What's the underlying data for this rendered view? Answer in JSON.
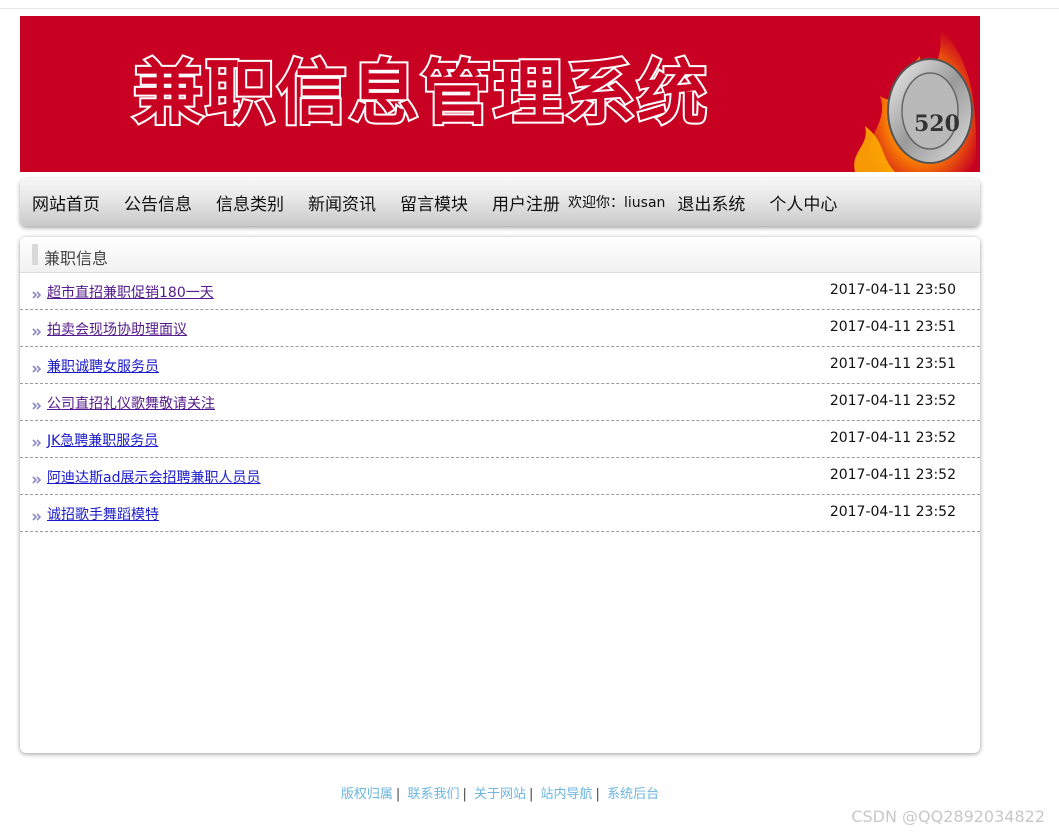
{
  "banner": {
    "title": "兼职信息管理系统",
    "emblem_text": "520",
    "background_color": "#c80021"
  },
  "nav": {
    "items": [
      {
        "label": "网站首页"
      },
      {
        "label": "公告信息"
      },
      {
        "label": "信息类别"
      },
      {
        "label": "新闻资讯"
      },
      {
        "label": "留言模块"
      },
      {
        "label": "用户注册"
      }
    ],
    "welcome": "欢迎你：liusan",
    "logout": "退出系统",
    "profile": "个人中心"
  },
  "panel": {
    "title": "兼职信息",
    "rows": [
      {
        "title": "超市直招兼职促销180一天",
        "date": "2017-04-11 23:50",
        "visited": true
      },
      {
        "title": "拍卖会现场协助理面议",
        "date": "2017-04-11 23:51",
        "visited": true
      },
      {
        "title": "兼职诚聘女服务员",
        "date": "2017-04-11 23:51",
        "visited": false
      },
      {
        "title": "公司直招礼仪歌舞敬请关注",
        "date": "2017-04-11 23:52",
        "visited": true
      },
      {
        "title": "JK急聘兼职服务员",
        "date": "2017-04-11 23:52",
        "visited": false
      },
      {
        "title": "阿迪达斯ad展示会招聘兼职人员员",
        "date": "2017-04-11 23:52",
        "visited": false
      },
      {
        "title": "诚招歌手舞蹈模特",
        "date": "2017-04-11 23:52",
        "visited": false
      }
    ],
    "row_icon": "double-chevron-icon"
  },
  "footer": {
    "links": [
      "版权归属",
      "联系我们",
      "关于网站",
      "站内导航",
      "系统后台"
    ],
    "link_color": "#6cb6e0"
  },
  "watermark": "CSDN @QQ2892034822"
}
